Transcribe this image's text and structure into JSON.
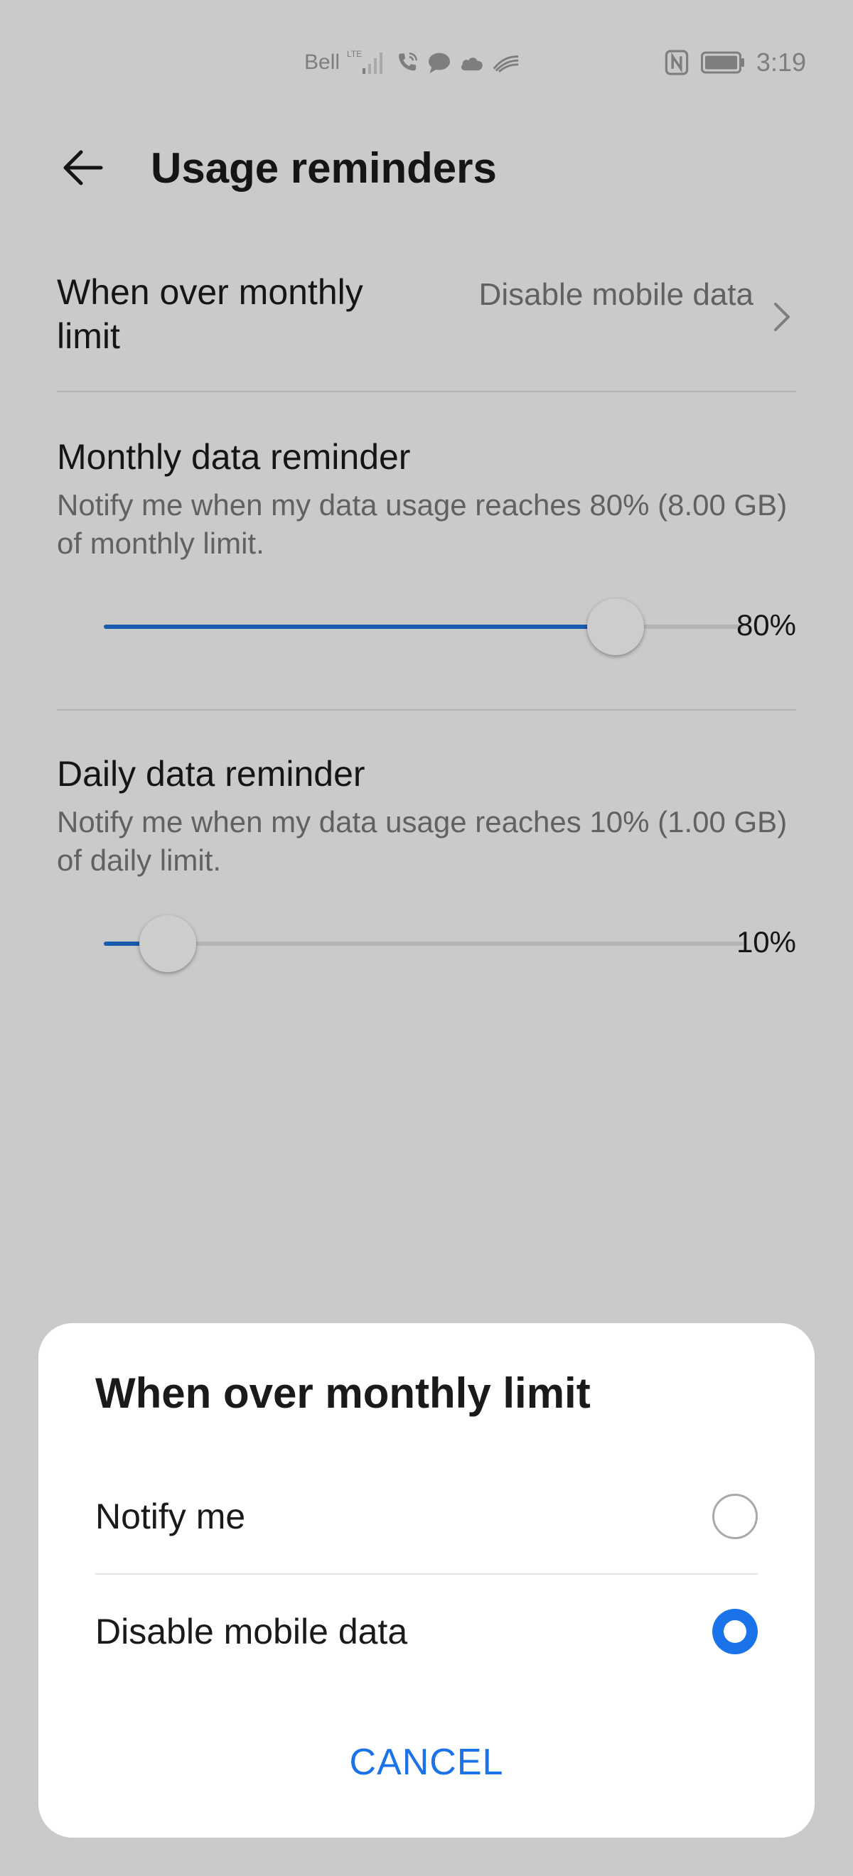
{
  "status_bar": {
    "carrier": "Bell",
    "network": "LTE",
    "time": "3:19",
    "icons": [
      "signal-icon",
      "wifi-call-icon",
      "chat-icon",
      "cloud-icon",
      "swype-icon",
      "nfc-icon",
      "battery-icon"
    ]
  },
  "header": {
    "title": "Usage reminders",
    "back_icon": "arrow-back-icon"
  },
  "limit_row": {
    "label": "When over monthly limit",
    "value": "Disable mobile data"
  },
  "monthly": {
    "title": "Monthly data reminder",
    "description": "Notify me when my data usage reaches 80% (8.00 GB) of monthly limit.",
    "percent_label": "80%",
    "percent": 80
  },
  "daily": {
    "title": "Daily data reminder",
    "description": "Notify me when my data usage reaches 10% (1.00 GB) of daily limit.",
    "percent_label": "10%",
    "percent": 10
  },
  "dialog": {
    "title": "When over monthly limit",
    "options": [
      {
        "label": "Notify me",
        "selected": false
      },
      {
        "label": "Disable mobile data",
        "selected": true
      }
    ],
    "cancel_label": "CANCEL"
  },
  "colors": {
    "accent": "#1a73e8",
    "slider_fill": "#1f6fd6",
    "background": "#f7f7f7",
    "dialog_bg": "#ffffff"
  }
}
